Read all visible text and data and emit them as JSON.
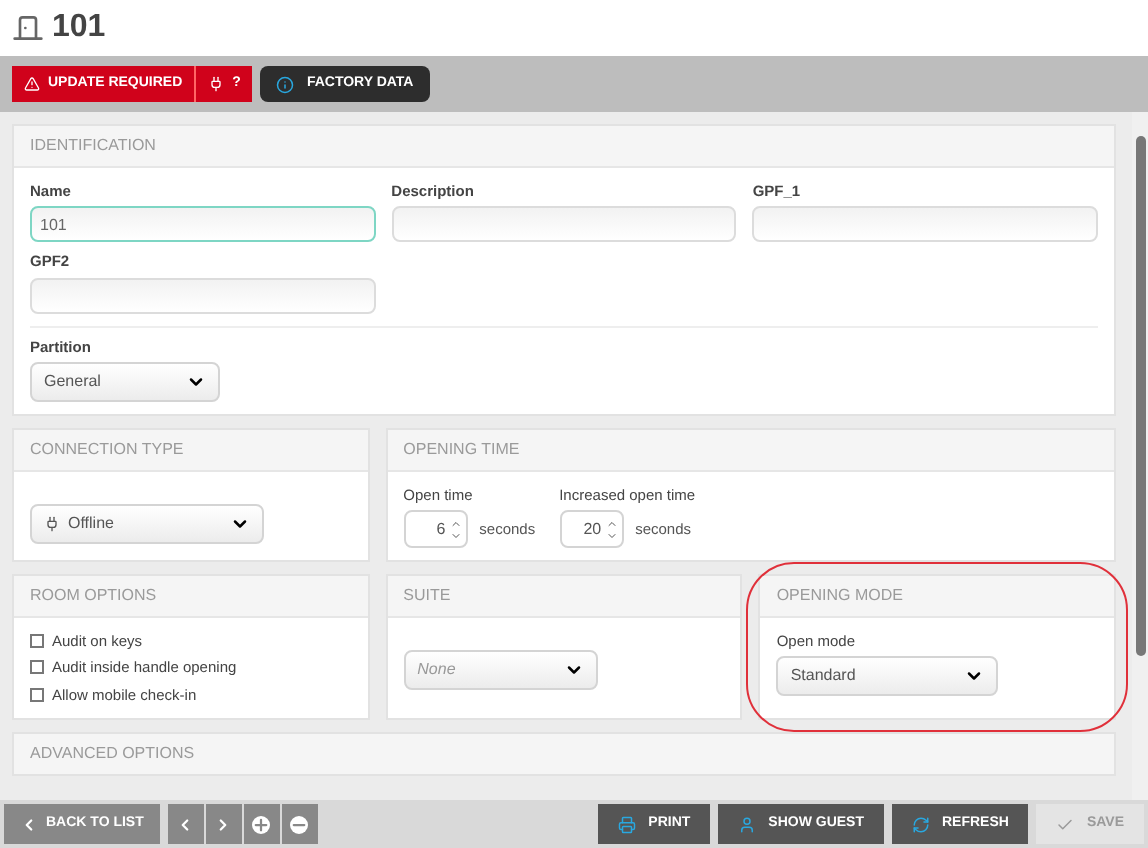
{
  "window": {
    "title": "101"
  },
  "toolbar": {
    "update_required": "UPDATE REQUIRED",
    "help": "?",
    "factory_data": "FACTORY DATA"
  },
  "identification": {
    "title": "IDENTIFICATION",
    "fields": [
      {
        "label": "Name",
        "value": "101",
        "focused": true
      },
      {
        "label": "Description",
        "focused": false
      },
      {
        "label": "GPF_1",
        "focused": false
      },
      {
        "label": "GPF2",
        "focused": false
      }
    ],
    "partition": {
      "label": "Partition",
      "value": "General"
    }
  },
  "connection_type": {
    "title": "CONNECTION TYPE",
    "value": "Offline"
  },
  "opening_time": {
    "title": "OPENING TIME",
    "fields": [
      {
        "label": "Open time",
        "value": "6",
        "unit": "seconds"
      },
      {
        "label": "Increased open time",
        "value": "20",
        "unit": "seconds"
      }
    ]
  },
  "room_options": {
    "title": "ROOM OPTIONS",
    "items": [
      {
        "label": "Audit on keys",
        "checked": false
      },
      {
        "label": "Audit inside handle opening",
        "checked": false
      },
      {
        "label": "Allow mobile check-in",
        "checked": false
      }
    ]
  },
  "suite": {
    "title": "SUITE",
    "placeholder": "None"
  },
  "opening_mode": {
    "title": "OPENING MODE",
    "label": "Open mode",
    "value": "Standard",
    "highlighted": true
  },
  "advanced_options": {
    "title": "ADVANCED OPTIONS"
  },
  "bottom_bar": {
    "back": "BACK TO LIST",
    "actions": [
      {
        "kind": "print",
        "label": "PRINT",
        "disabled": false
      },
      {
        "kind": "guest",
        "label": "SHOW GUEST",
        "disabled": false
      },
      {
        "kind": "refresh",
        "label": "REFRESH",
        "disabled": false
      },
      {
        "kind": "save",
        "label": "SAVE",
        "disabled": true
      }
    ]
  }
}
